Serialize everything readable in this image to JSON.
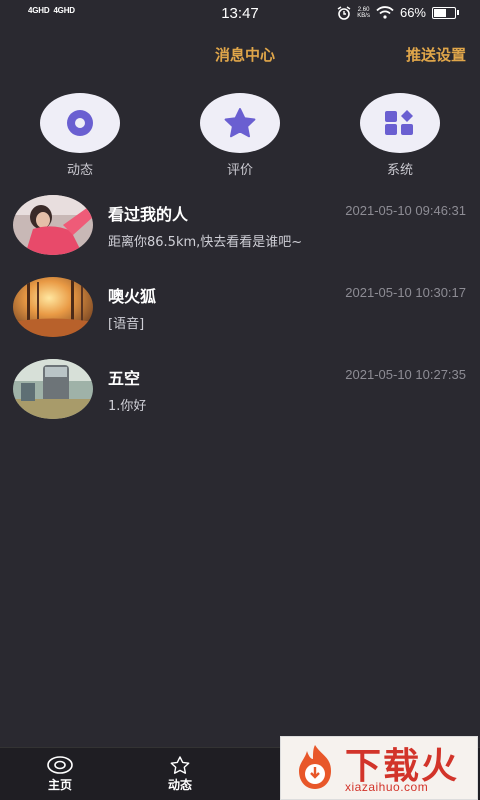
{
  "status_bar": {
    "network1": "4GHD",
    "network2": "4GHD",
    "time": "13:47",
    "speed_value": "2.60",
    "speed_unit": "KB/s",
    "battery": "66%",
    "battery_level": 0.66
  },
  "header": {
    "title": "消息中心",
    "action": "推送设置"
  },
  "categories": [
    {
      "label": "动态",
      "icon": "record-icon"
    },
    {
      "label": "评价",
      "icon": "star-icon"
    },
    {
      "label": "系统",
      "icon": "grid-icon"
    }
  ],
  "messages": [
    {
      "name": "看过我的人",
      "time": "2021-05-10 09:46:31",
      "preview": "距离你86.5km,快去看看是谁吧~"
    },
    {
      "name": "噢火狐",
      "time": "2021-05-10 10:30:17",
      "preview": "[语音]"
    },
    {
      "name": "五空",
      "time": "2021-05-10 10:27:35",
      "preview": "1.你好"
    }
  ],
  "tabbar": {
    "items": [
      {
        "label": "主页",
        "icon": "home-icon"
      },
      {
        "label": "动态",
        "icon": "star-icon"
      }
    ]
  },
  "watermark": {
    "text": "下载火",
    "domain": "xiazaihuo.com"
  },
  "colors": {
    "background": "#2a2930",
    "accent": "#e0a64a",
    "icon_purple": "#6a5fd1"
  }
}
